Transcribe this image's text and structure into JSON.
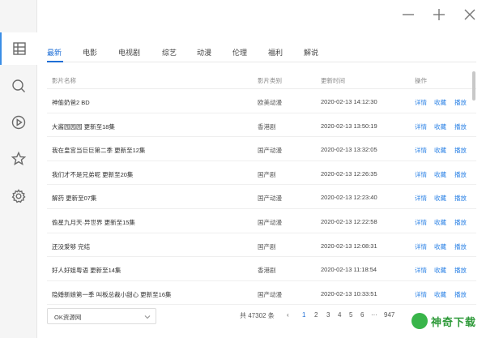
{
  "tabs": [
    "最新",
    "电影",
    "电视剧",
    "综艺",
    "动漫",
    "伦理",
    "福利",
    "解说"
  ],
  "table": {
    "headers": {
      "name": "影片名称",
      "type": "影片类别",
      "time": "更新时间",
      "action": "操作"
    },
    "actions": {
      "detail": "详情",
      "favorite": "收藏",
      "play": "播放"
    },
    "rows": [
      {
        "name": "神偷奶爸2 BD",
        "type": "欧美动漫",
        "time": "2020-02-13 14:12:30"
      },
      {
        "name": "大酱园园园 更新至18集",
        "type": "香港剧",
        "time": "2020-02-13 13:50:19"
      },
      {
        "name": "我在皇宫当巨巨第二季 更新至12集",
        "type": "国产动漫",
        "time": "2020-02-13 13:32:05"
      },
      {
        "name": "我们才不是兄弟呢 更新至20集",
        "type": "国产剧",
        "time": "2020-02-13 12:26:35"
      },
      {
        "name": "解药 更新至07集",
        "type": "国产动漫",
        "time": "2020-02-13 12:23:40"
      },
      {
        "name": "偷星九月天·异世界 更新至15集",
        "type": "国产动漫",
        "time": "2020-02-13 12:22:58"
      },
      {
        "name": "还没爱够 完结",
        "type": "国产剧",
        "time": "2020-02-13 12:08:31"
      },
      {
        "name": "好人好姐粤语 更新至14集",
        "type": "香港剧",
        "time": "2020-02-13 11:18:54"
      },
      {
        "name": "隐婚新娘第一季 叫板总裁小甜心 更新至16集",
        "type": "国产动漫",
        "time": "2020-02-13 10:33:51"
      }
    ]
  },
  "source": {
    "value": "OK资源网"
  },
  "pager": {
    "total": "共 47302 条",
    "prev": "‹",
    "pages": [
      "1",
      "2",
      "3",
      "4",
      "5",
      "6",
      "···",
      "947"
    ],
    "next": "›"
  },
  "logo": {
    "text": "神奇下载"
  },
  "colors": {
    "accent": "#1f6fd6",
    "link": "#2d83e6",
    "logo": "#39b54a"
  }
}
